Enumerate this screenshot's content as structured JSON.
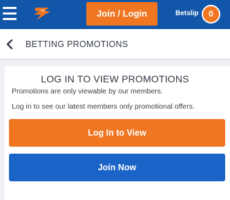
{
  "header": {
    "menu_icon": "hamburger-menu-icon",
    "logo_icon": "brand-logo-icon",
    "join_login_label": "Join / Login",
    "betslip_label": "Betslip",
    "betslip_count": "0",
    "colors": {
      "bar": "#1156a8",
      "accent": "#f07622"
    }
  },
  "subheader": {
    "back_icon": "chevron-left-icon",
    "title": "BETTING PROMOTIONS"
  },
  "promo": {
    "title": "LOG IN TO VIEW PROMOTIONS",
    "line1": "Promotions are only viewable by our members.",
    "line2": "Log in to see our latest members only promotional offers.",
    "login_button": "Log In to View",
    "join_button": "Join Now",
    "colors": {
      "login": "#f07622",
      "join": "#1a63c7"
    }
  }
}
